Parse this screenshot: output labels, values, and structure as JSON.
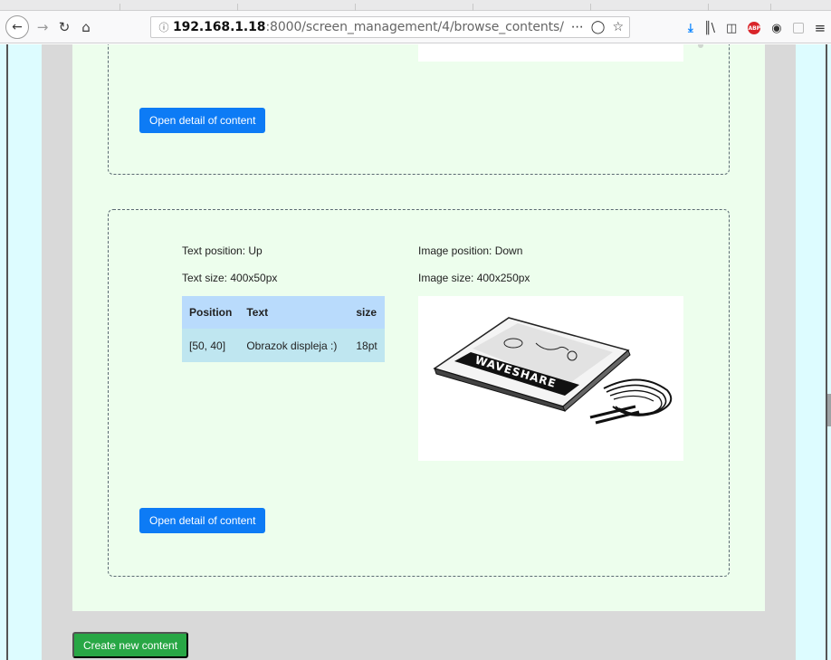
{
  "browser": {
    "url_host": "192.168.1.18",
    "url_path": ":8000/screen_management/4/browse_contents/",
    "icons": [
      "back-arrow-icon",
      "forward-arrow-icon",
      "reload-icon",
      "home-icon",
      "info-icon",
      "more-icon",
      "pocket-icon",
      "bookmark-star-icon",
      "download-icon",
      "library-icon",
      "sidebar-icon",
      "adblock-icon",
      "account-icon",
      "extension-icon",
      "menu-icon"
    ]
  },
  "cards": [
    {
      "open_button": "Open detail of content"
    },
    {
      "text_position": "Text position: Up",
      "text_size": "Text size: 400x50px",
      "image_position": "Image position: Down",
      "image_size": "Image size: 400x250px",
      "table": {
        "headers": [
          "Position",
          "Text",
          "size"
        ],
        "rows": [
          [
            "[50, 40]",
            "Obrazok displeja :)",
            "18pt"
          ]
        ]
      },
      "image_logo_text": "WAVESHARE",
      "open_button": "Open detail of content"
    }
  ],
  "create_button": "Create new content",
  "colors": {
    "primary": "#0d7bf5",
    "success": "#28a745",
    "content_bg": "#edfeed",
    "side_bg": "#ddfcff",
    "table_head": "#b9dbfc",
    "table_cell": "#bfe6f0"
  }
}
